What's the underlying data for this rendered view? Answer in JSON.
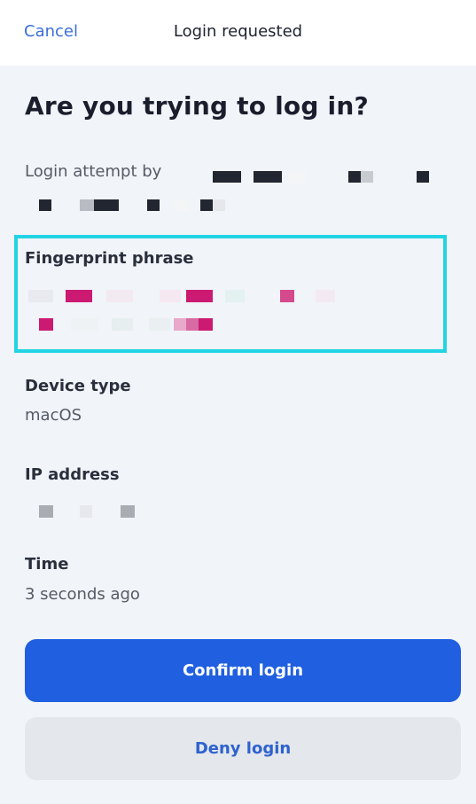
{
  "header": {
    "cancel_label": "Cancel",
    "title": "Login requested"
  },
  "main": {
    "heading": "Are you trying to log in?",
    "login_attempt_label": "Login attempt by",
    "fingerprint_label": "Fingerprint phrase",
    "device_type_label": "Device type",
    "device_type_value": "macOS",
    "ip_address_label": "IP address",
    "time_label": "Time",
    "time_value": "3 seconds ago"
  },
  "actions": {
    "confirm_label": "Confirm login",
    "deny_label": "Deny login"
  },
  "colors": {
    "accent": "#1f5fe0",
    "highlight_border": "#22d4e3",
    "fingerprint_redaction": "#cc1a73"
  }
}
